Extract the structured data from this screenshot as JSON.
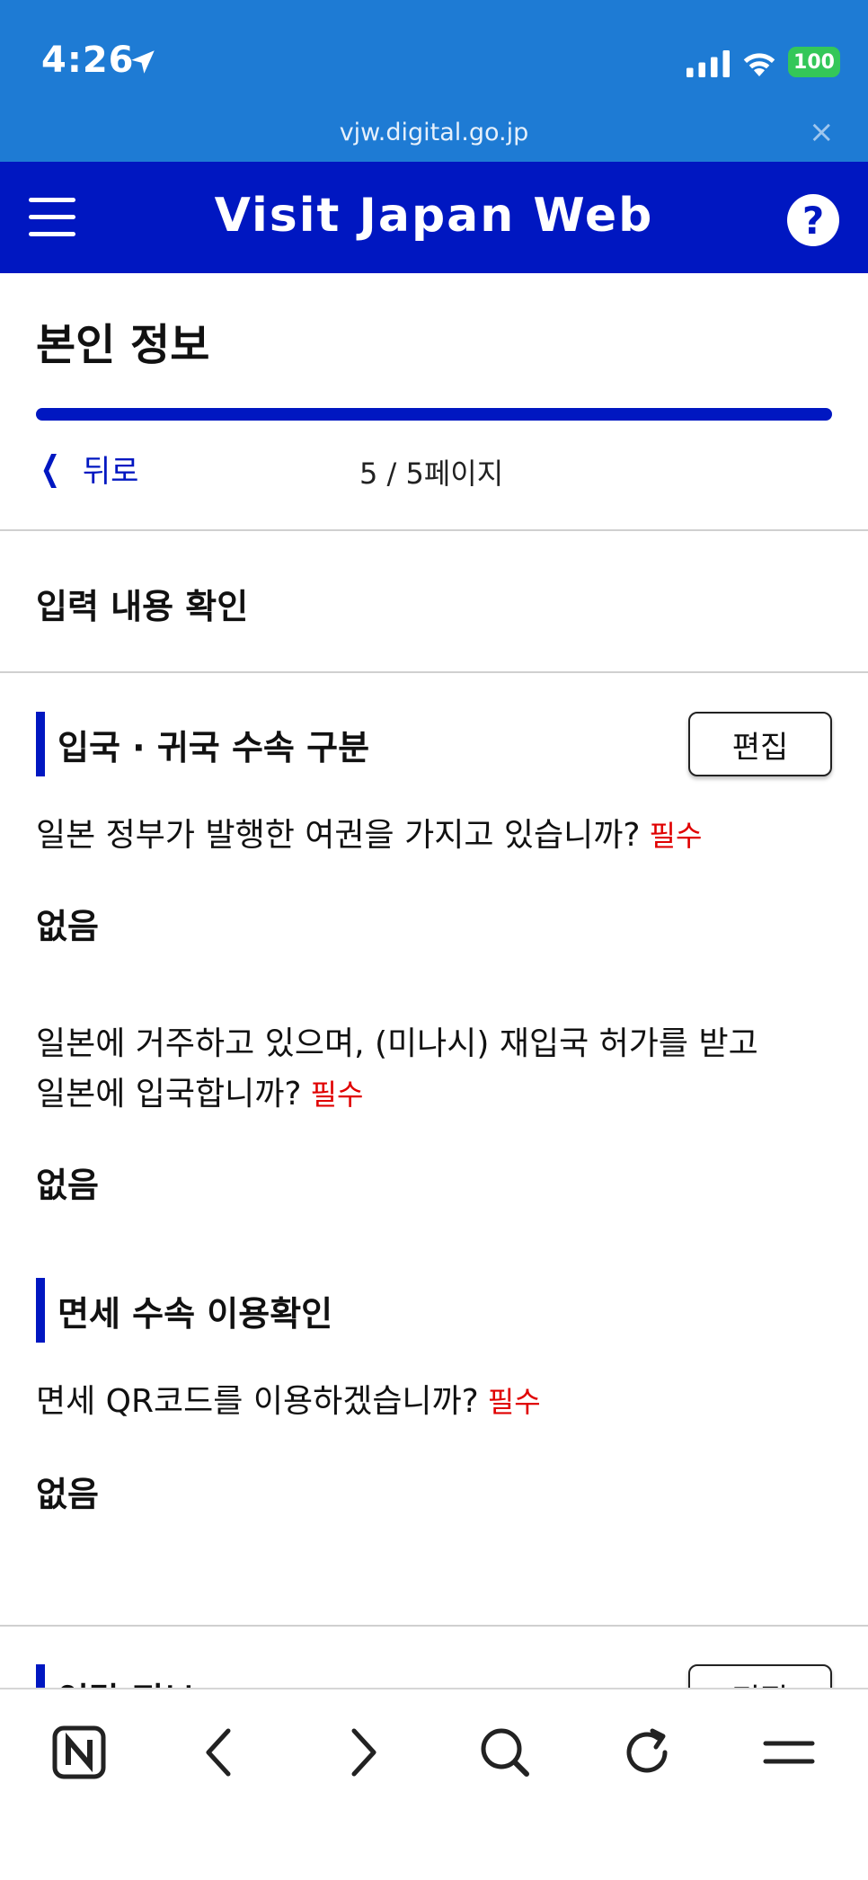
{
  "status_bar": {
    "time": "4:26",
    "battery": "100"
  },
  "browser": {
    "url": "vjw.digital.go.jp",
    "close_glyph": "×"
  },
  "header": {
    "title": "Visit Japan Web",
    "help_glyph": "?"
  },
  "page": {
    "title": "본인 정보",
    "back_label": "뒤로",
    "page_count": "5 / 5페이지",
    "progress": 1.0
  },
  "section_title": "입력 내용 확인",
  "blocks": [
    {
      "heading": "입국 · 귀국 수속 구분",
      "edit_label": "편집",
      "items": [
        {
          "question": "일본 정부가 발행한 여권을 가지고 있습니까?",
          "required": "필수",
          "answer": "없음"
        },
        {
          "question_line1": "일본에 거주하고 있으며, (미나시) 재입국 허가를 받고",
          "question_line2": "일본에 입국합니까?",
          "required": "필수",
          "answer": "없음"
        }
      ]
    },
    {
      "heading": "면세 수속 이용확인",
      "items": [
        {
          "question": "면세 QR코드를 이용하겠습니까?",
          "required": "필수",
          "answer": "없음"
        }
      ]
    },
    {
      "heading": "연락 정보",
      "edit_label": "편집"
    }
  ],
  "toolbar": {
    "icons": [
      "naver-icon",
      "back-icon",
      "forward-icon",
      "search-icon",
      "reload-icon",
      "menu-icon"
    ],
    "naver_glyph": "N"
  },
  "colors": {
    "chrome_blue": "#1e7bd4",
    "brand_navy": "#0017c1",
    "required_red": "#e00000",
    "battery_green": "#34c759"
  }
}
